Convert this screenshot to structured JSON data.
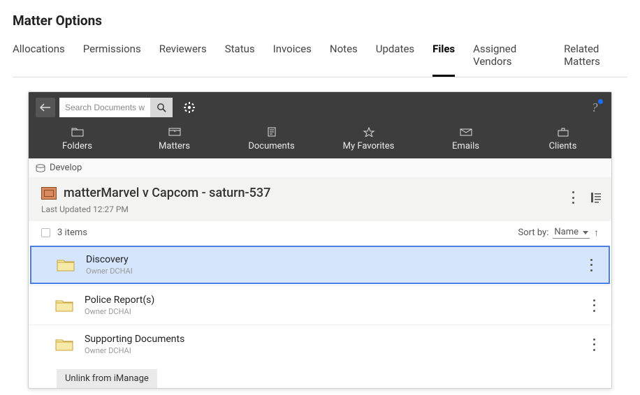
{
  "page_title": "Matter Options",
  "tabs": [
    "Allocations",
    "Permissions",
    "Reviewers",
    "Status",
    "Invoices",
    "Notes",
    "Updates",
    "Files",
    "Assigned Vendors",
    "Related Matters"
  ],
  "active_tab_index": 7,
  "toolbar": {
    "search_placeholder": "Search Documents with",
    "categories": [
      "Folders",
      "Matters",
      "Documents",
      "My Favorites",
      "Emails",
      "Clients"
    ]
  },
  "breadcrumb": "Develop",
  "matter": {
    "title": "matterMarvel v Capcom - saturn-537",
    "last_updated_label": "Last Updated",
    "last_updated_time": "12:27 PM"
  },
  "list": {
    "count_label": "3 items",
    "sort_label": "Sort by:",
    "sort_value": "Name",
    "owner_prefix": "Owner",
    "rows": [
      {
        "name": "Discovery",
        "owner": "DCHAI",
        "selected": true
      },
      {
        "name": "Police Report(s)",
        "owner": "DCHAI",
        "selected": false
      },
      {
        "name": "Supporting Documents",
        "owner": "DCHAI",
        "selected": false
      }
    ]
  },
  "unlink_label": "Unlink from iManage"
}
